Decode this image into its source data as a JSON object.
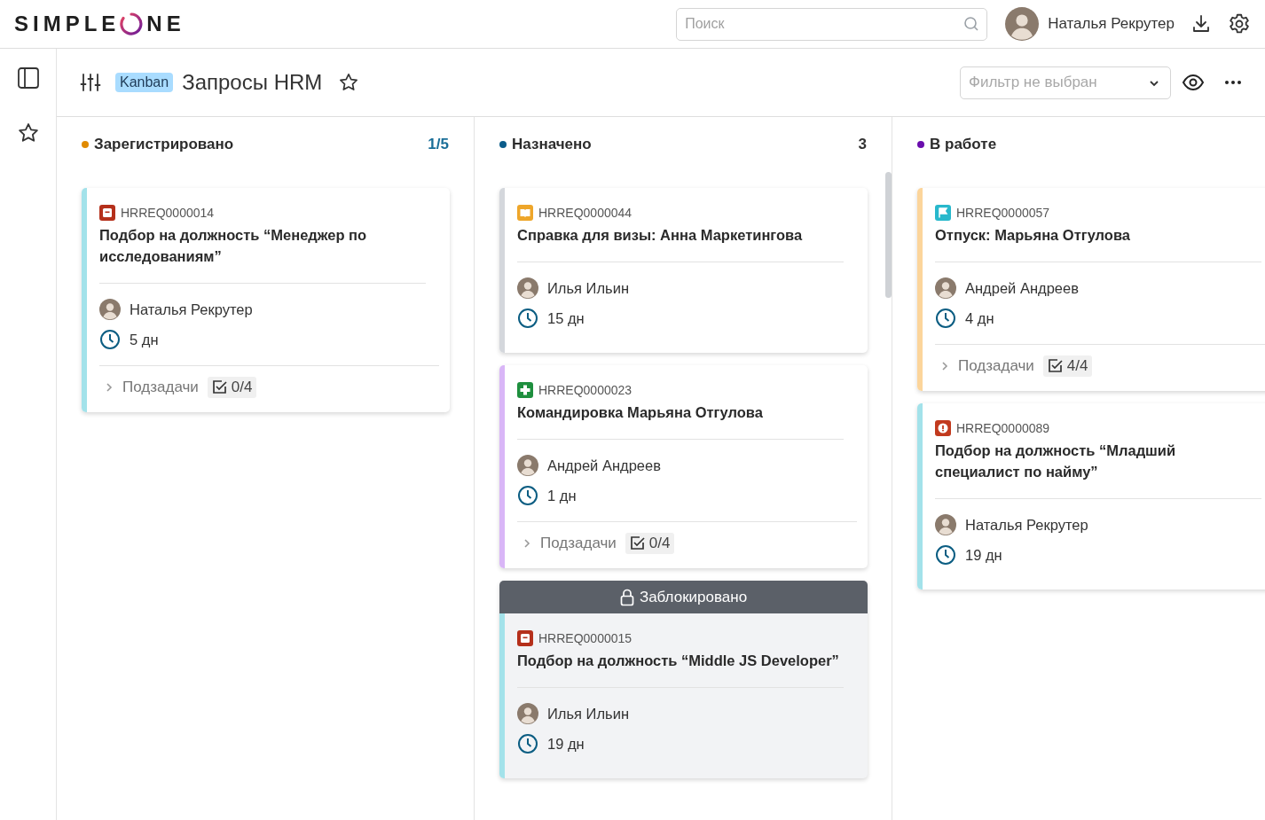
{
  "header": {
    "logo": {
      "before": "SIMPLE",
      "after": "NE"
    },
    "search": {
      "placeholder": "Поиск"
    },
    "user": {
      "name": "Наталья Рекрутер"
    }
  },
  "toolbar": {
    "badge": "Kanban",
    "title": "Запросы HRM",
    "filter": {
      "placeholder": "Фильтр не выбран"
    }
  },
  "columns": [
    {
      "title": "Зарегистрировано",
      "color": "#e08a00",
      "count": "1/5",
      "count_highlighted": true,
      "cards": [
        {
          "kind": "recruit",
          "id": "HRREQ0000014",
          "title": "Подбор на должность “Менеджер по исследованиям”",
          "color": "#a3e2ea",
          "assignee": "Наталья Рекрутер",
          "duration": "5 дн",
          "subtasks": {
            "label": "Подзадачи",
            "count": "0/4"
          }
        }
      ]
    },
    {
      "title": "Назначено",
      "color": "#0a5c8a",
      "count": "3",
      "count_highlighted": false,
      "cards": [
        {
          "kind": "book",
          "id": "HRREQ0000044",
          "title": "Справка для визы: Анна Маркетингова",
          "color": "#d4d7dc",
          "assignee": "Илья Ильин",
          "duration": "15 дн"
        },
        {
          "kind": "plus",
          "id": "HRREQ0000023",
          "title": "Командировка Марьяна Отгулова",
          "color": "#d9b6f7",
          "assignee": "Андрей Андреев",
          "duration": "1 дн",
          "subtasks": {
            "label": "Подзадачи",
            "count": "0/4"
          }
        },
        {
          "kind": "recruit",
          "id": "HRREQ0000015",
          "title": "Подбор на должность “Middle JS Developer”",
          "color": "#a3e2ea",
          "assignee": "Илья Ильин",
          "duration": "19 дн",
          "blocked": {
            "label": "Заблокировано"
          }
        }
      ]
    },
    {
      "title": "В работе",
      "color": "#6a0dad",
      "cards": [
        {
          "kind": "flag",
          "id": "HRREQ0000057",
          "title": "Отпуск: Марьяна Отгулова",
          "color": "#fcd59b",
          "assignee": "Андрей Андреев",
          "duration": "4 дн",
          "subtasks": {
            "label": "Подзадачи",
            "count": "4/4"
          }
        },
        {
          "kind": "alert",
          "id": "HRREQ0000089",
          "title": "Подбор на должность “Младший специалист по найму”",
          "color": "#a3e2ea",
          "assignee": "Наталья Рекрутер",
          "duration": "19 дн"
        }
      ]
    }
  ]
}
